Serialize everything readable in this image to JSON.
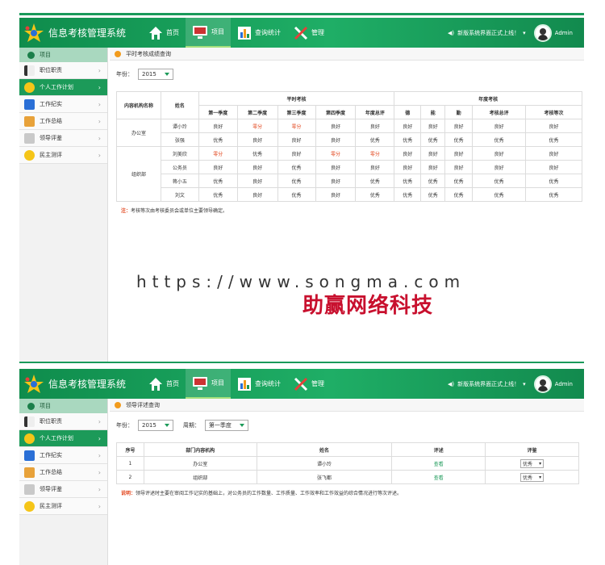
{
  "app": {
    "title": "信息考核管理系统",
    "nav": [
      "首页",
      "项目",
      "查询统计",
      "管理"
    ],
    "notice": "新版系统界面正式上线！",
    "user": "Admin"
  },
  "sidebar": {
    "header": "项目",
    "items": [
      "职位职责",
      "个人工作计划",
      "工作纪实",
      "工作总结",
      "领导评鉴",
      "民主测评"
    ]
  },
  "panel1": {
    "breadcrumb": "平时考核成绩查询",
    "year_label": "年份：",
    "year_value": "2015",
    "table": {
      "h_org": "内容机构名称",
      "h_name": "姓名",
      "h_regular": "平时考核",
      "h_annual": "年度考核",
      "regular_cols": [
        "第一季度",
        "第二季度",
        "第三季度",
        "第四季度",
        "年度总评"
      ],
      "annual_cols": [
        "德",
        "能",
        "勤",
        "考核总评",
        "考核等次"
      ],
      "groups": [
        {
          "org": "办公室",
          "rows": [
            {
              "name": "谭小玲",
              "cells": [
                "良好",
                "零分",
                "零分",
                "良好",
                "良好",
                "良好",
                "良好",
                "良好",
                "良好",
                "良好"
              ]
            },
            {
              "name": "张强",
              "cells": [
                "优秀",
                "良好",
                "良好",
                "良好",
                "优秀",
                "优秀",
                "优秀",
                "优秀",
                "优秀",
                "优秀"
              ]
            }
          ]
        },
        {
          "org": "组织部",
          "rows": [
            {
              "name": "刘美欣",
              "cells": [
                "零分",
                "优秀",
                "良好",
                "零分",
                "零分",
                "良好",
                "良好",
                "良好",
                "良好",
                "良好"
              ]
            },
            {
              "name": "公务员",
              "cells": [
                "良好",
                "良好",
                "优秀",
                "良好",
                "良好",
                "良好",
                "良好",
                "良好",
                "良好",
                "良好"
              ]
            },
            {
              "name": "蒋小五",
              "cells": [
                "优秀",
                "良好",
                "优秀",
                "良好",
                "优秀",
                "优秀",
                "优秀",
                "优秀",
                "优秀",
                "优秀"
              ]
            },
            {
              "name": "刘文",
              "cells": [
                "优秀",
                "良好",
                "优秀",
                "良好",
                "优秀",
                "优秀",
                "优秀",
                "优秀",
                "优秀",
                "优秀"
              ]
            }
          ]
        }
      ]
    },
    "note_label": "注：",
    "note_text": "考核等次由考核委员会或单位主要领导确定。"
  },
  "watermark": {
    "url": "https://www.songma.com",
    "brand": "助赢网络科技"
  },
  "panel2": {
    "breadcrumb": "领导评述查询",
    "year_label": "年份：",
    "year_value": "2015",
    "period_label": "周期：",
    "period_value": "第一季度",
    "table": {
      "headers": [
        "序号",
        "部门内容机构",
        "姓名",
        "评述",
        "评鉴"
      ],
      "rows": [
        {
          "no": "1",
          "org": "办公室",
          "name": "谭小玲",
          "comment": "查看",
          "rating": "优秀"
        },
        {
          "no": "2",
          "org": "组织部",
          "name": "张飞都",
          "comment": "查看",
          "rating": "优秀"
        }
      ]
    },
    "note_label": "说明：",
    "note_text": "领导评述时主要在审阅工作记实的基础上，对公务员的工作数量、工作质量、工作效率和工作效益的综合情况进行等次评述。"
  },
  "colors": {
    "brand_green": "#1c9a59",
    "warn_red": "#e2451c",
    "brand_red": "#c8102e"
  },
  "icons": [
    "house-icon",
    "monitor-icon",
    "chart-icon",
    "tools-icon",
    "speaker-icon",
    "chevron-down-icon",
    "chevron-right-icon"
  ]
}
